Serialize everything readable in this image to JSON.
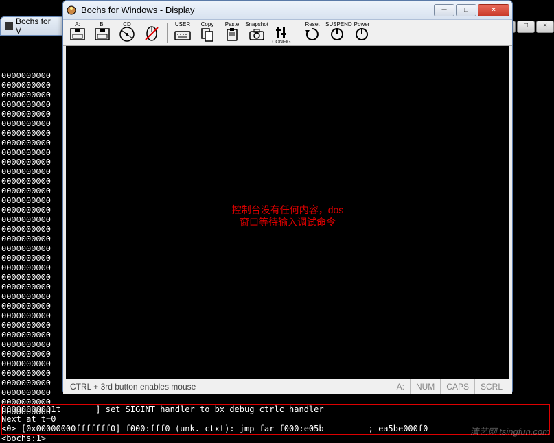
{
  "bg_window": {
    "title_partial": "Bochs for V",
    "win_buttons": {
      "min": "─",
      "max": "□",
      "close": "×"
    }
  },
  "console": {
    "hex_line": "0000000000",
    "partial_line": "00000000001t       ] set SIGINT handler to bx_debug_ctrlc_handler",
    "next_line": "Next at t=0",
    "disasm_line": "<0> [0x00000000fffffff0] f000:fff0 (unk. ctxt): jmp far f000:e05b         ; ea5be000f0",
    "prompt_line": "<bochs:1>"
  },
  "main_window": {
    "title": "Bochs for Windows - Display",
    "win_buttons": {
      "min": "─",
      "max": "□",
      "close": "×"
    },
    "toolbar": {
      "drive_a": "A:",
      "drive_b": "B:",
      "cd": "CD",
      "mouse": "mouse",
      "user": "USER",
      "copy": "Copy",
      "paste": "Paste",
      "snapshot": "Snapshot",
      "config": "CONFIG",
      "reset": "Reset",
      "suspend": "SUSPEND",
      "power": "Power"
    },
    "overlay": "控制台没有任何内容，dos\n窗口等待输入调试命令",
    "statusbar": {
      "hint": "CTRL + 3rd button enables mouse",
      "a": "A:",
      "num": "NUM",
      "caps": "CAPS",
      "scrl": "SCRL"
    }
  },
  "watermark": "清艺网\ntsingfun.com"
}
